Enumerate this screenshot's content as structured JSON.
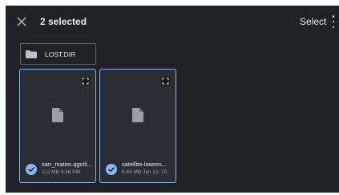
{
  "header": {
    "close_icon": "close-icon",
    "title": "2 selected",
    "select_label": "Select",
    "more_icon": "more-vert-icon"
  },
  "folder": {
    "icon": "folder-icon",
    "name": "LOST.DIR"
  },
  "files": [
    {
      "name": "san_mateo.qgctil...",
      "meta": "112 MB 9:46 PM",
      "selected": true,
      "icon": "document-icon"
    },
    {
      "name": "satellite-lowres...",
      "meta": "8.44 MB Jan 12, 20...",
      "selected": true,
      "icon": "document-icon"
    }
  ],
  "colors": {
    "background": "#202124",
    "card": "#2a2d31",
    "accent": "#8ab4f8",
    "text": "#e8eaed",
    "muted": "#9aa0a6"
  }
}
